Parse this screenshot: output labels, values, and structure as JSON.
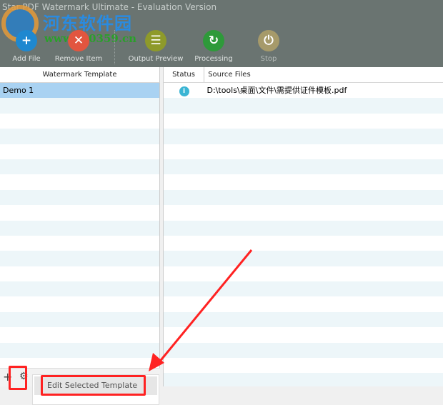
{
  "window": {
    "title": "Star PDF Watermark Ultimate - Evaluation Version"
  },
  "watermark": {
    "cn": "河东软件园",
    "url": "www.pc0359.cn"
  },
  "toolbar": {
    "add_file": "Add File",
    "remove_item": "Remove Item",
    "output_preview": "Output Preview",
    "processing": "Processing",
    "stop": "Stop"
  },
  "left_panel": {
    "header": "Watermark Template",
    "items": [
      "Demo 1"
    ]
  },
  "right_panel": {
    "headers": {
      "status": "Status",
      "source": "Source Files"
    },
    "rows": [
      {
        "status_icon": "info-icon",
        "file": "D:\\tools\\桌面\\文件\\需提供证件模板.pdf"
      }
    ]
  },
  "footer": {
    "add": "+",
    "settings": "⚙"
  },
  "context_menu": {
    "item": "Edit Selected Template"
  }
}
